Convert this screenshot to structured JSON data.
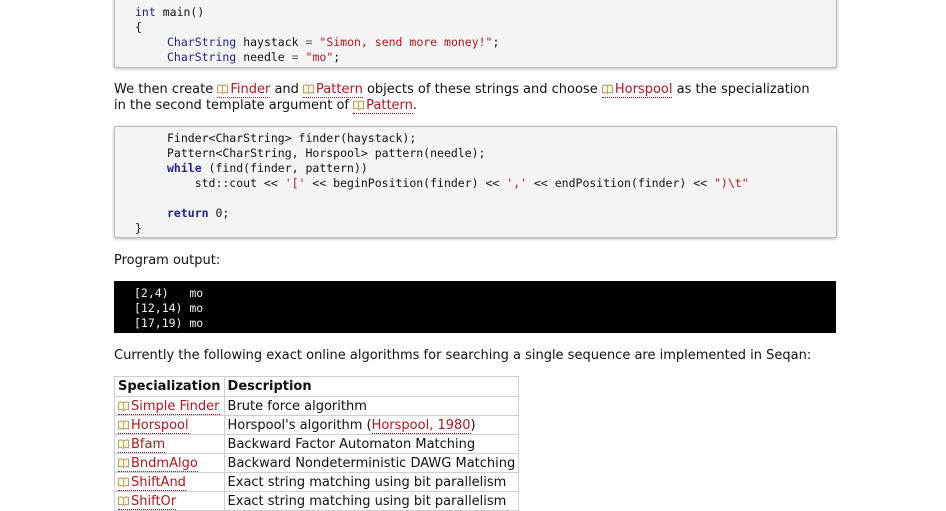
{
  "code1": {
    "lines": [
      "int main()",
      "{",
      "    CharString haystack = \"Simon, send more money!\";",
      "    CharString needle = \"mo\";"
    ],
    "kw_int": "int",
    "fn_main": "main()",
    "brace_open": "{",
    "type_charstring": "CharString",
    "var_haystack": "haystack",
    "var_needle": "needle",
    "eq": "=",
    "str_haystack": "\"Simon, send more money!\"",
    "str_needle": "\"mo\"",
    "semi": ";"
  },
  "para1": {
    "t1": "We then create ",
    "link_finder": "Finder",
    "t2": " and ",
    "link_pattern": "Pattern",
    "t3": " objects of these strings and choose ",
    "link_horspool": "Horspool",
    "t4": " as the specialization",
    "line2_t1": "in the second template argument of ",
    "line2_link": "Pattern",
    "line2_t2": "."
  },
  "code2": {
    "l1_a": "Finder<CharString> finder(haystack);",
    "l2_a": "Pattern<CharString, Horspool> pattern(needle);",
    "l3_kw": "while",
    "l3_rest": " (find(finder, pattern))",
    "l4_a": "    std::cout << ",
    "l4_s1": "'['",
    "l4_b": " << beginPosition(finder) << ",
    "l4_s2": "','",
    "l4_c": " << endPosition(finder) << ",
    "l4_s3": "\")\\t\"",
    "l6_kw": "return",
    "l6_rest": " 0;",
    "brace_close": "}"
  },
  "output_label": "Program output:",
  "output_lines": [
    "[2,4)   mo",
    "[12,14) mo",
    "[17,19) mo"
  ],
  "para2": "Currently the following exact online algorithms for searching a single sequence are implemented in Seqan:",
  "table": {
    "headers": [
      "Specialization",
      "Description"
    ],
    "rows": [
      {
        "spec": "Simple Finder",
        "desc": "Brute force algorithm"
      },
      {
        "spec": "Horspool",
        "desc_pre": "Horspool's algorithm (",
        "desc_link": "Horspool, 1980",
        "desc_post": ")"
      },
      {
        "spec": "Bfam",
        "desc": "Backward Factor Automaton Matching"
      },
      {
        "spec": "BndmAlgo",
        "desc": "Backward Nondeterministic DAWG Matching"
      },
      {
        "spec": "ShiftAnd",
        "desc": "Exact string matching using bit parallelism"
      },
      {
        "spec": "ShiftOr",
        "desc": "Exact string matching using bit parallelism"
      }
    ]
  },
  "colors": {
    "link": "#b5151e",
    "keyword": "#1f1f8f",
    "output_bg": "#000000"
  },
  "icons": {
    "link_icon": "book-icon"
  }
}
